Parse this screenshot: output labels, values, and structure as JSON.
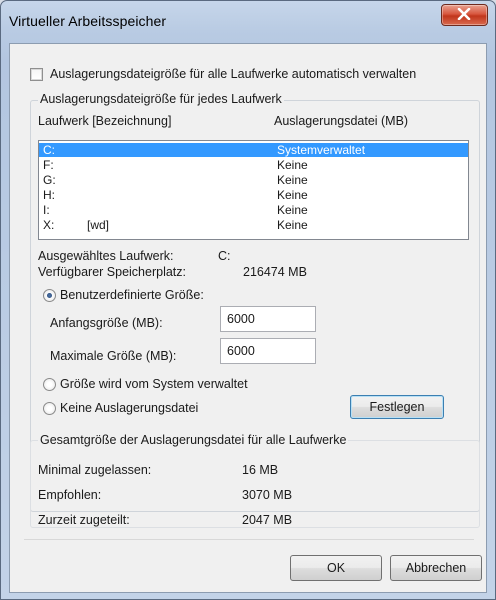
{
  "window": {
    "title": "Virtueller Arbeitsspeicher"
  },
  "auto_manage": {
    "label": "Auslagerungsdateigröße für alle Laufwerke automatisch verwalten",
    "checked": false
  },
  "per_drive_group": {
    "legend": "Auslagerungsdateigröße für jedes Laufwerk",
    "col_drive": "Laufwerk [Bezeichnung]",
    "col_pagefile": "Auslagerungsdatei (MB)",
    "drives": [
      {
        "letter": "C:",
        "label": "",
        "pagefile": "Systemverwaltet",
        "selected": true
      },
      {
        "letter": "F:",
        "label": "",
        "pagefile": "Keine",
        "selected": false
      },
      {
        "letter": "G:",
        "label": "",
        "pagefile": "Keine",
        "selected": false
      },
      {
        "letter": "H:",
        "label": "",
        "pagefile": "Keine",
        "selected": false
      },
      {
        "letter": "I:",
        "label": "",
        "pagefile": "Keine",
        "selected": false
      },
      {
        "letter": "X:",
        "label": "[wd]",
        "pagefile": "Keine",
        "selected": false
      }
    ],
    "selected_drive_label": "Ausgewähltes Laufwerk:",
    "selected_drive_value": "C:",
    "free_space_label": "Verfügbarer Speicherplatz:",
    "free_space_value": "216474 MB",
    "custom_size_label": "Benutzerdefinierte Größe:",
    "initial_size_label": "Anfangsgröße (MB):",
    "initial_size_value": "6000",
    "max_size_label": "Maximale Größe (MB):",
    "max_size_value": "6000",
    "system_managed_label": "Größe wird vom System verwaltet",
    "no_pagefile_label": "Keine Auslagerungsdatei",
    "set_button": "Festlegen",
    "selected_option": "custom"
  },
  "total_group": {
    "legend": "Gesamtgröße der Auslagerungsdatei für alle Laufwerke",
    "min_label": "Minimal zugelassen:",
    "min_value": "16 MB",
    "recommended_label": "Empfohlen:",
    "recommended_value": "3070 MB",
    "current_label": "Zurzeit zugeteilt:",
    "current_value": "2047 MB"
  },
  "buttons": {
    "ok": "OK",
    "cancel": "Abbrechen"
  },
  "colors": {
    "selection": "#3399ff",
    "close_button": "#c1361c",
    "frame": "#b9cbe3"
  },
  "icons": {
    "close": "close-icon"
  }
}
